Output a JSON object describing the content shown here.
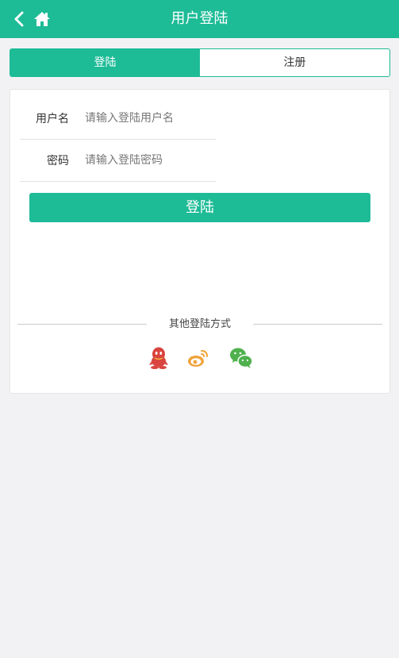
{
  "header": {
    "title": "用户登陆",
    "back_icon": "chevron-left-icon",
    "home_icon": "home-icon",
    "color": "#1dbb96"
  },
  "tabs": [
    {
      "label": "登陆",
      "active": true
    },
    {
      "label": "注册",
      "active": false
    }
  ],
  "form": {
    "username": {
      "label": "用户名",
      "placeholder": "请输入登陆用户名",
      "value": ""
    },
    "password": {
      "label": "密码",
      "placeholder": "请输入登陆密码",
      "value": ""
    }
  },
  "login_button": "登陆",
  "other_login": {
    "label": "其他登陆方式",
    "icons": [
      "qq-icon",
      "weibo-icon",
      "wechat-icon"
    ]
  },
  "colors": {
    "accent": "#1dbb96",
    "qq": "#d9443e",
    "weibo": "#f0a33a",
    "wechat": "#4fb14e"
  }
}
